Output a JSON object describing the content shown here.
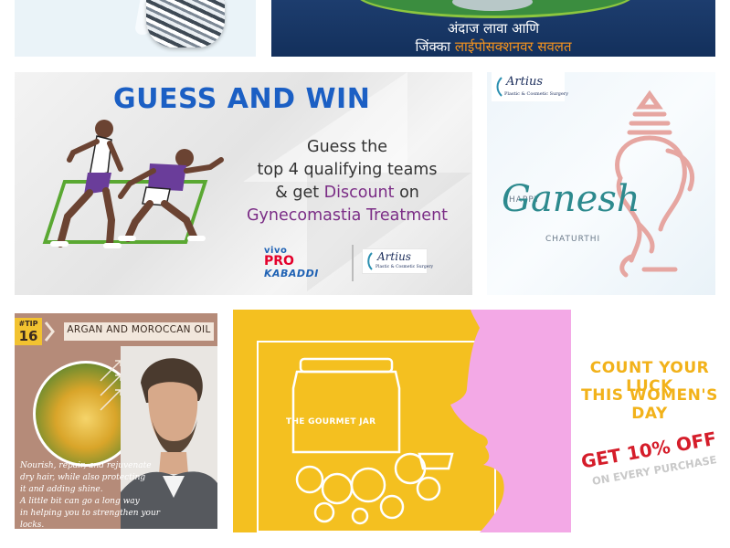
{
  "top_right": {
    "line1": "अंदाज लावा आणि",
    "line2_prefix": "जिंक्का",
    "line2_highlight": "लाईपोसक्शनवर सवलत"
  },
  "guess": {
    "headline": "GUESS AND WIN",
    "line1": "Guess the",
    "line2": "top 4 qualifying teams",
    "line3_prefix": "& get",
    "line3_highlight": "Discount",
    "line3_suffix": "on",
    "line4": "Gynecomastia Treatment",
    "sponsor_vivo": "vivo",
    "sponsor_pro": "PRO",
    "sponsor_kabaddi": "KABADDI",
    "logo_name": "Artius",
    "logo_sub": "Plastic & Cosmetic Surgery"
  },
  "ganesh": {
    "logo_name": "Artius",
    "logo_sub": "Plastic & Cosmetic Surgery",
    "happy": "HAPPY",
    "name": "Ganesh",
    "chaturthi": "CHATURTHI"
  },
  "tip": {
    "tag": "#TIP",
    "number": "16",
    "title": "ARGAN AND MOROCCAN OIL",
    "body": [
      "Nourish, repair, and rejuvenate",
      "dry hair, while also protecting",
      "it and adding shine.",
      "A little bit can go a long way",
      "in helping you to strengthen your locks."
    ]
  },
  "women": {
    "jar_label": "THE GOURMET JAR",
    "count_line1": "COUNT YOUR LUCK",
    "count_line2": "THIS WOMEN'S DAY",
    "offer": "GET 10% OFF",
    "offer_sub": "ON EVERY PURCHASE"
  },
  "colors": {
    "guess_blue": "#1b5fc4",
    "purple": "#7b2d86",
    "field_green": "#5aa832",
    "teal": "#2d8a8e",
    "ganesh_pink": "#e6a6a1",
    "women_yellow": "#f4c020",
    "offer_red": "#d51d2a",
    "count_gold": "#f2b21a",
    "face_pink": "#f3a9e6"
  }
}
